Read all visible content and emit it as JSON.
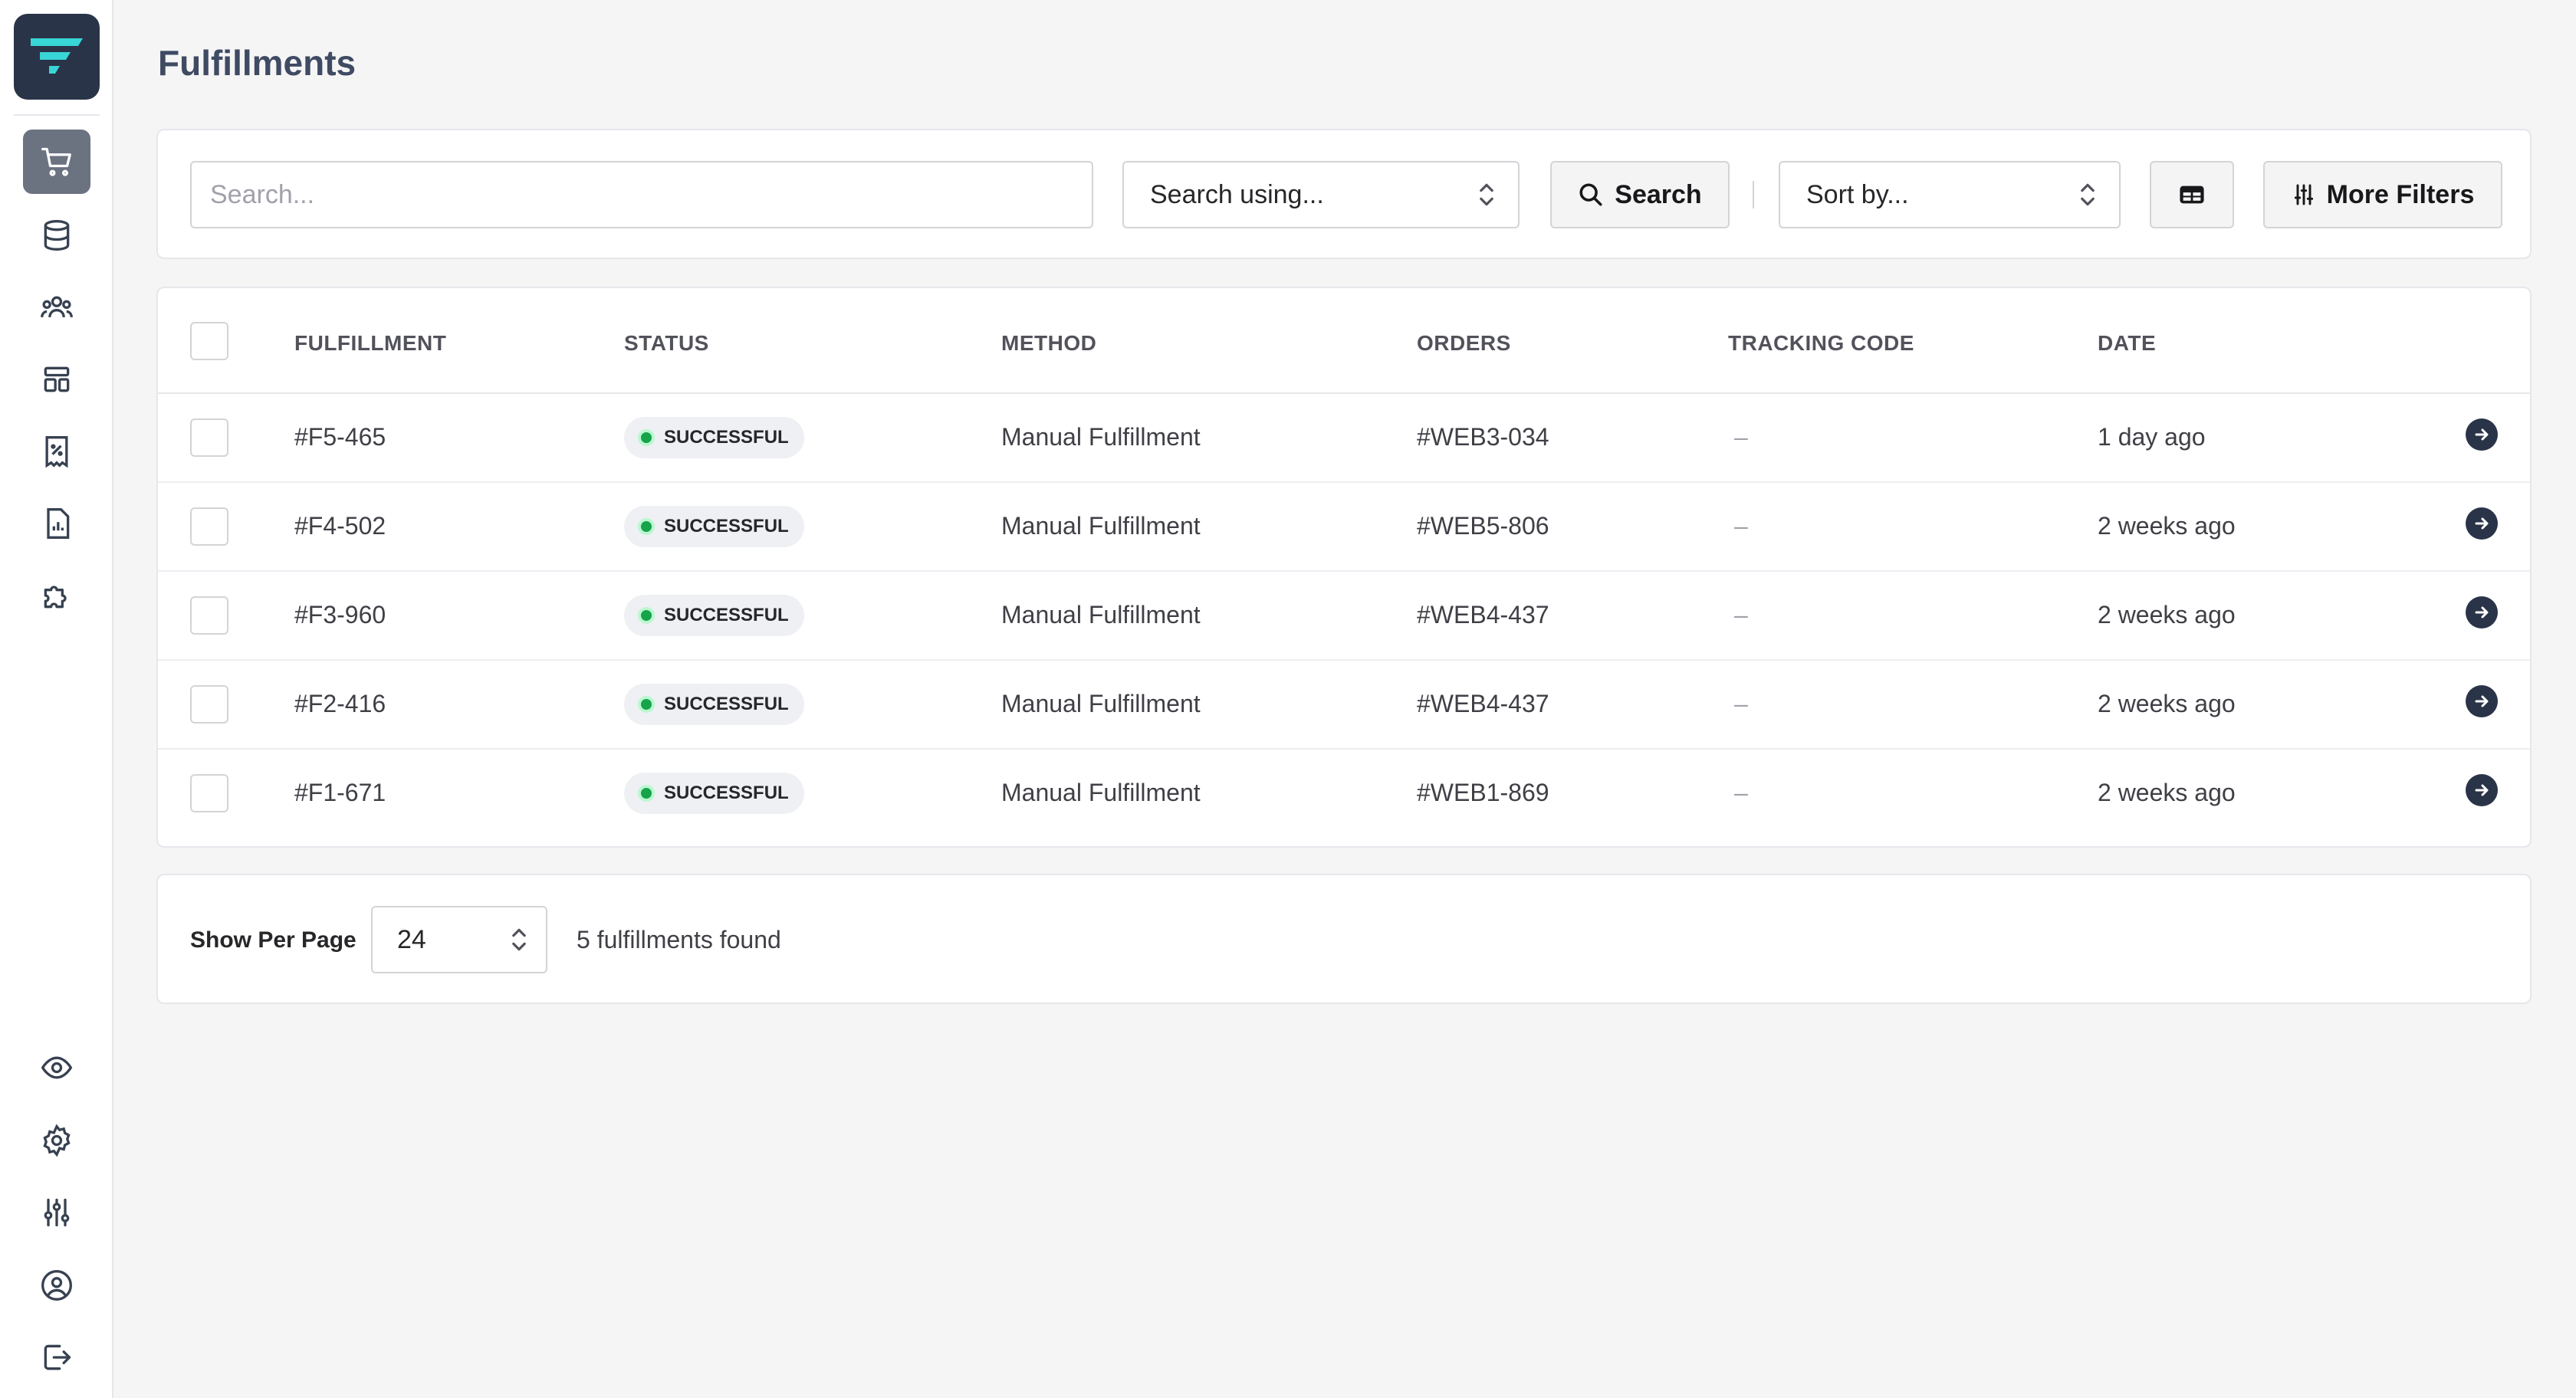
{
  "page": {
    "title": "Fulfillments"
  },
  "sidebar": {
    "items": [
      {
        "icon": "cart-icon",
        "active": true
      },
      {
        "icon": "database-icon"
      },
      {
        "icon": "users-icon"
      },
      {
        "icon": "layout-icon"
      },
      {
        "icon": "receipt-discount-icon"
      },
      {
        "icon": "report-icon"
      },
      {
        "icon": "puzzle-icon"
      }
    ],
    "bottom_items": [
      {
        "icon": "eye-icon"
      },
      {
        "icon": "gear-icon"
      },
      {
        "icon": "sliders-icon"
      },
      {
        "icon": "user-circle-icon"
      },
      {
        "icon": "logout-icon"
      }
    ]
  },
  "toolbar": {
    "search_placeholder": "Search...",
    "search_using": "Search using...",
    "search_button": "Search",
    "sort_by": "Sort by...",
    "more_filters": "More Filters"
  },
  "table": {
    "columns": [
      "FULFILLMENT",
      "STATUS",
      "METHOD",
      "ORDERS",
      "TRACKING CODE",
      "DATE"
    ],
    "rows": [
      {
        "id": "#F5-465",
        "status": "SUCCESSFUL",
        "method": "Manual Fulfillment",
        "order": "#WEB3-034",
        "tracking": "–",
        "date": "1 day ago"
      },
      {
        "id": "#F4-502",
        "status": "SUCCESSFUL",
        "method": "Manual Fulfillment",
        "order": "#WEB5-806",
        "tracking": "–",
        "date": "2 weeks ago"
      },
      {
        "id": "#F3-960",
        "status": "SUCCESSFUL",
        "method": "Manual Fulfillment",
        "order": "#WEB4-437",
        "tracking": "–",
        "date": "2 weeks ago"
      },
      {
        "id": "#F2-416",
        "status": "SUCCESSFUL",
        "method": "Manual Fulfillment",
        "order": "#WEB4-437",
        "tracking": "–",
        "date": "2 weeks ago"
      },
      {
        "id": "#F1-671",
        "status": "SUCCESSFUL",
        "method": "Manual Fulfillment",
        "order": "#WEB1-869",
        "tracking": "–",
        "date": "2 weeks ago"
      }
    ]
  },
  "footer": {
    "per_page_label": "Show Per Page",
    "per_page_value": "24",
    "found_text": "5 fulfillments found"
  },
  "colors": {
    "sidebar_dark": "#2a3448",
    "active_nav": "#6b7280",
    "status_green": "#16a34a",
    "logo_accent": "#38d6d6"
  }
}
